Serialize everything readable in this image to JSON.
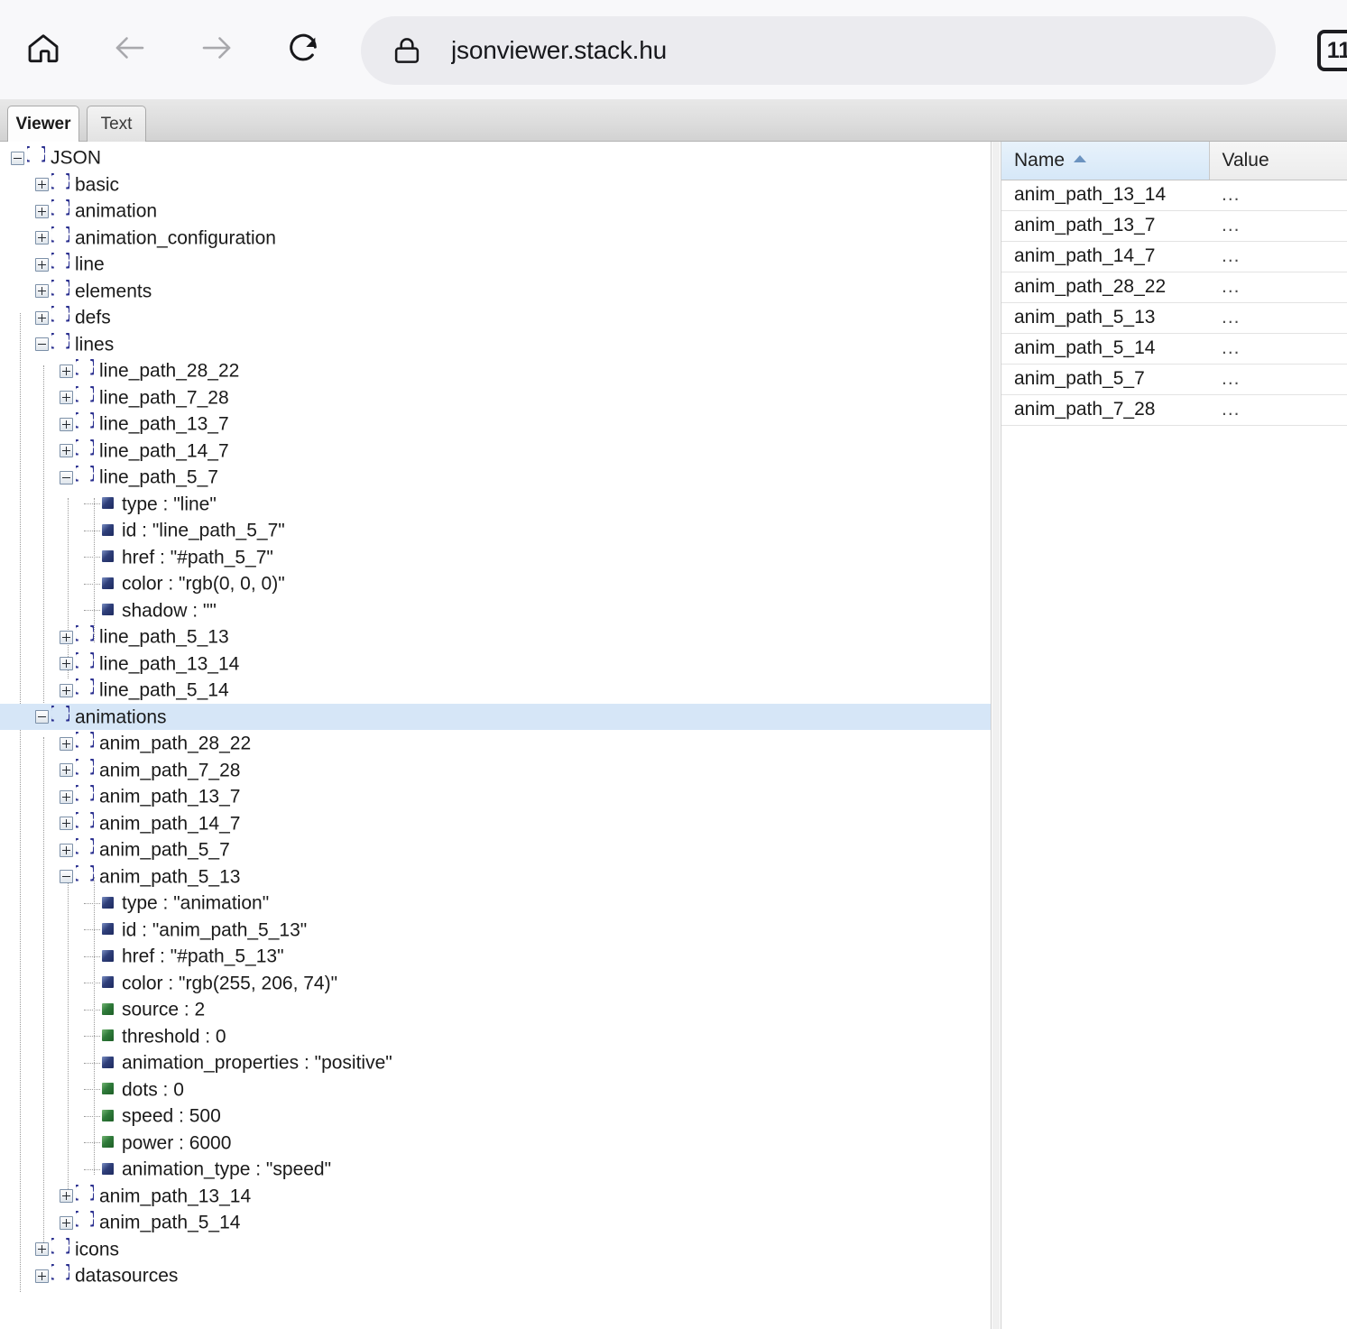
{
  "browser": {
    "home_icon": "home-icon",
    "back_icon": "arrow-left-icon",
    "forward_icon": "arrow-right-icon",
    "reload_icon": "reload-icon",
    "lock_icon": "lock-icon",
    "url": "jsonviewer.stack.hu",
    "tab_count": "11"
  },
  "tabs": [
    {
      "label": "Viewer",
      "active": true
    },
    {
      "label": "Text",
      "active": false
    }
  ],
  "tree": [
    {
      "depth": 0,
      "kind": "object",
      "state": "minus",
      "label": "JSON",
      "selected": false
    },
    {
      "depth": 1,
      "kind": "object",
      "state": "plus",
      "label": "basic",
      "selected": false
    },
    {
      "depth": 1,
      "kind": "object",
      "state": "plus",
      "label": "animation",
      "selected": false
    },
    {
      "depth": 1,
      "kind": "object",
      "state": "plus",
      "label": "animation_configuration",
      "selected": false
    },
    {
      "depth": 1,
      "kind": "object",
      "state": "plus",
      "label": "line",
      "selected": false
    },
    {
      "depth": 1,
      "kind": "object",
      "state": "plus",
      "label": "elements",
      "selected": false
    },
    {
      "depth": 1,
      "kind": "object",
      "state": "plus",
      "label": "defs",
      "selected": false
    },
    {
      "depth": 1,
      "kind": "object",
      "state": "minus",
      "label": "lines",
      "selected": false
    },
    {
      "depth": 2,
      "kind": "object",
      "state": "plus",
      "label": "line_path_28_22",
      "selected": false
    },
    {
      "depth": 2,
      "kind": "object",
      "state": "plus",
      "label": "line_path_7_28",
      "selected": false
    },
    {
      "depth": 2,
      "kind": "object",
      "state": "plus",
      "label": "line_path_13_7",
      "selected": false
    },
    {
      "depth": 2,
      "kind": "object",
      "state": "plus",
      "label": "line_path_14_7",
      "selected": false
    },
    {
      "depth": 2,
      "kind": "object",
      "state": "minus",
      "label": "line_path_5_7",
      "selected": false
    },
    {
      "depth": 3,
      "kind": "string",
      "label": "type : \"line\"",
      "selected": false
    },
    {
      "depth": 3,
      "kind": "string",
      "label": "id : \"line_path_5_7\"",
      "selected": false
    },
    {
      "depth": 3,
      "kind": "string",
      "label": "href : \"#path_5_7\"",
      "selected": false
    },
    {
      "depth": 3,
      "kind": "string",
      "label": "color : \"rgb(0, 0, 0)\"",
      "selected": false
    },
    {
      "depth": 3,
      "kind": "string",
      "label": "shadow : \"\"",
      "selected": false
    },
    {
      "depth": 2,
      "kind": "object",
      "state": "plus",
      "label": "line_path_5_13",
      "selected": false
    },
    {
      "depth": 2,
      "kind": "object",
      "state": "plus",
      "label": "line_path_13_14",
      "selected": false
    },
    {
      "depth": 2,
      "kind": "object",
      "state": "plus",
      "label": "line_path_5_14",
      "selected": false
    },
    {
      "depth": 1,
      "kind": "object",
      "state": "minus",
      "label": "animations",
      "selected": true
    },
    {
      "depth": 2,
      "kind": "object",
      "state": "plus",
      "label": "anim_path_28_22",
      "selected": false
    },
    {
      "depth": 2,
      "kind": "object",
      "state": "plus",
      "label": "anim_path_7_28",
      "selected": false
    },
    {
      "depth": 2,
      "kind": "object",
      "state": "plus",
      "label": "anim_path_13_7",
      "selected": false
    },
    {
      "depth": 2,
      "kind": "object",
      "state": "plus",
      "label": "anim_path_14_7",
      "selected": false
    },
    {
      "depth": 2,
      "kind": "object",
      "state": "plus",
      "label": "anim_path_5_7",
      "selected": false
    },
    {
      "depth": 2,
      "kind": "object",
      "state": "minus",
      "label": "anim_path_5_13",
      "selected": false
    },
    {
      "depth": 3,
      "kind": "string",
      "label": "type : \"animation\"",
      "selected": false
    },
    {
      "depth": 3,
      "kind": "string",
      "label": "id : \"anim_path_5_13\"",
      "selected": false
    },
    {
      "depth": 3,
      "kind": "string",
      "label": "href : \"#path_5_13\"",
      "selected": false
    },
    {
      "depth": 3,
      "kind": "string",
      "label": "color : \"rgb(255, 206, 74)\"",
      "selected": false
    },
    {
      "depth": 3,
      "kind": "number",
      "label": "source : 2",
      "selected": false
    },
    {
      "depth": 3,
      "kind": "number",
      "label": "threshold : 0",
      "selected": false
    },
    {
      "depth": 3,
      "kind": "string",
      "label": "animation_properties : \"positive\"",
      "selected": false
    },
    {
      "depth": 3,
      "kind": "number",
      "label": "dots : 0",
      "selected": false
    },
    {
      "depth": 3,
      "kind": "number",
      "label": "speed : 500",
      "selected": false
    },
    {
      "depth": 3,
      "kind": "number",
      "label": "power : 6000",
      "selected": false
    },
    {
      "depth": 3,
      "kind": "string",
      "label": "animation_type : \"speed\"",
      "selected": false
    },
    {
      "depth": 2,
      "kind": "object",
      "state": "plus",
      "label": "anim_path_13_14",
      "selected": false
    },
    {
      "depth": 2,
      "kind": "object",
      "state": "plus",
      "label": "anim_path_5_14",
      "selected": false
    },
    {
      "depth": 1,
      "kind": "object",
      "state": "plus",
      "label": "icons",
      "selected": false
    },
    {
      "depth": 1,
      "kind": "object",
      "state": "plus",
      "label": "datasources",
      "selected": false
    }
  ],
  "table": {
    "columns": [
      {
        "label": "Name",
        "sorted": "asc"
      },
      {
        "label": "Value",
        "sorted": ""
      }
    ],
    "rows": [
      {
        "name": "anim_path_13_14",
        "value": "..."
      },
      {
        "name": "anim_path_13_7",
        "value": "..."
      },
      {
        "name": "anim_path_14_7",
        "value": "..."
      },
      {
        "name": "anim_path_28_22",
        "value": "..."
      },
      {
        "name": "anim_path_5_13",
        "value": "..."
      },
      {
        "name": "anim_path_5_14",
        "value": "..."
      },
      {
        "name": "anim_path_5_7",
        "value": "..."
      },
      {
        "name": "anim_path_7_28",
        "value": "..."
      }
    ]
  },
  "colors": {
    "selection": "#d6e6f7",
    "string_marker": "#2f3f7a",
    "number_marker": "#2f7a3a",
    "brace_icon": "#2a2f8f"
  }
}
